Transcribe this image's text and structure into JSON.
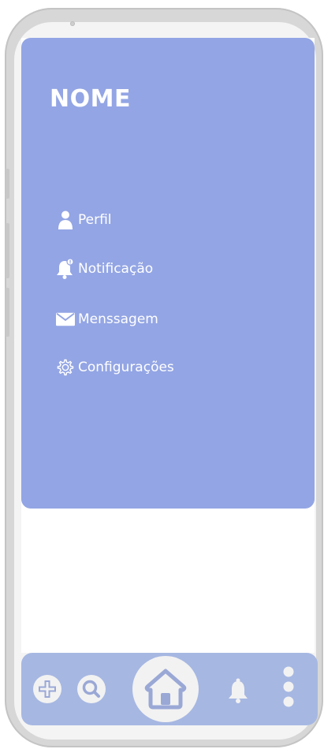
{
  "drawer": {
    "title": "NOME",
    "items": [
      {
        "label": "Perfil",
        "icon": "person-icon"
      },
      {
        "label": "Notificação",
        "icon": "bell-icon"
      },
      {
        "label": "Menssagem",
        "icon": "envelope-icon"
      },
      {
        "label": "Configurações",
        "icon": "gear-icon"
      }
    ]
  },
  "bottom_nav": {
    "icons": [
      "add-icon",
      "search-icon",
      "home-icon",
      "bell-icon",
      "more-vertical-icon"
    ]
  },
  "colors": {
    "drawer_bg": "#93a5e4",
    "bottom_bar_bg": "#a6b7e2",
    "icon_light": "#f2f2f2",
    "icon_dark": "#9aa8d6",
    "phone_frame": "#d7d7d7"
  }
}
